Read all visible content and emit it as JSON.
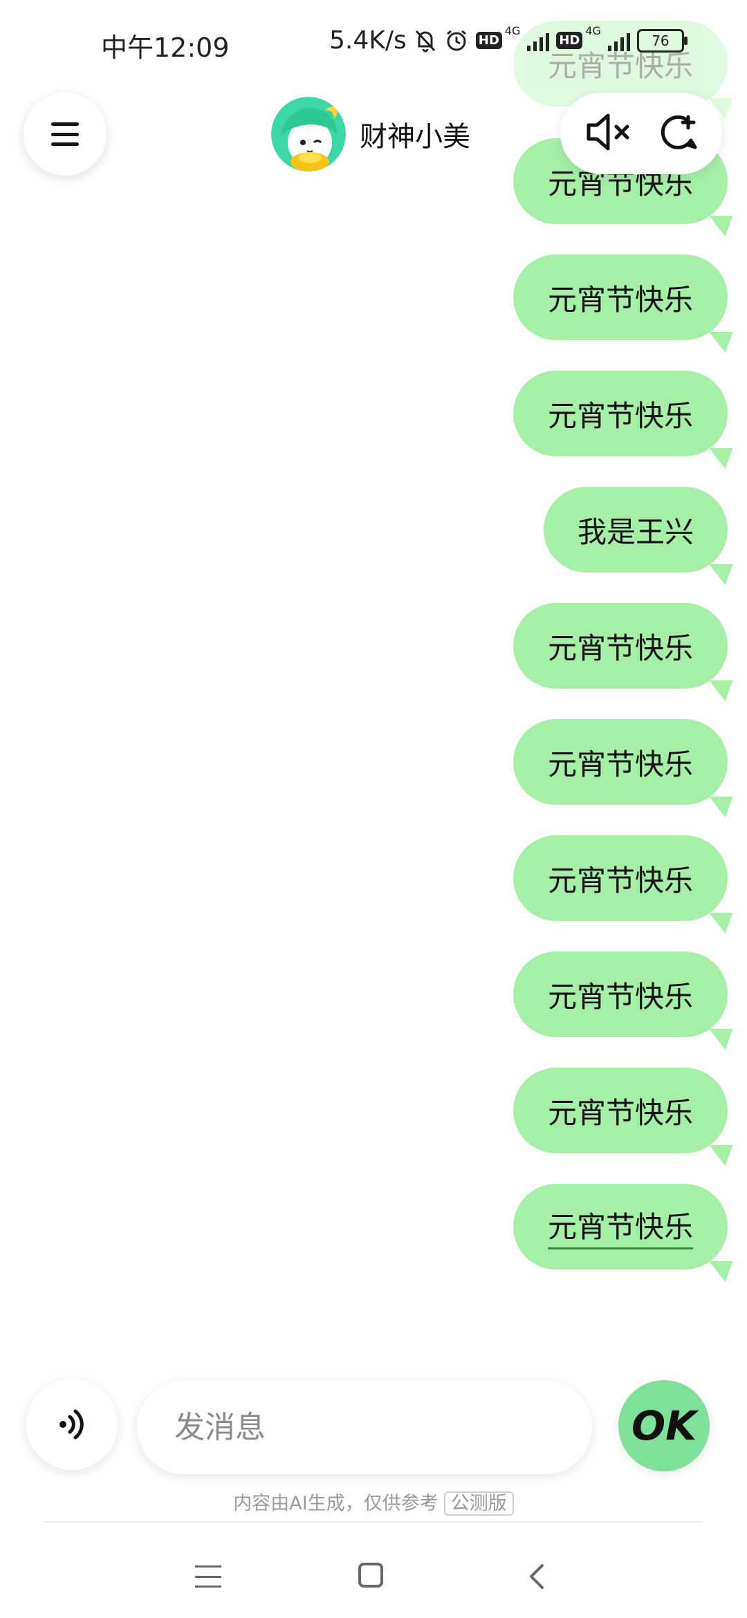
{
  "status_bar": {
    "time": "中午12:09",
    "speed": "5.4K/s",
    "hd1": "HD",
    "net1": "4G",
    "hd2": "HD",
    "net2": "4G",
    "battery": "76"
  },
  "header": {
    "title": "财神小美",
    "icons": {
      "menu": "menu-icon",
      "mute": "speaker-muted-icon",
      "new_chat": "new-chat-icon"
    }
  },
  "messages": [
    {
      "text": "元宵节快乐"
    },
    {
      "text": "元宵节快乐"
    },
    {
      "text": "元宵节快乐"
    },
    {
      "text": "元宵节快乐"
    },
    {
      "text": "我是王兴"
    },
    {
      "text": "元宵节快乐"
    },
    {
      "text": "元宵节快乐"
    },
    {
      "text": "元宵节快乐"
    },
    {
      "text": "元宵节快乐"
    },
    {
      "text": "元宵节快乐"
    },
    {
      "text": "元宵节快乐"
    }
  ],
  "input": {
    "placeholder": "发消息",
    "ok_label": "OK"
  },
  "footer": {
    "disclaimer": "内容由AI生成，仅供参考",
    "badge": "公测版"
  },
  "colors": {
    "bubble": "#a6efa6",
    "ok_button": "#7fe09a",
    "avatar_hair": "#3ed6a6"
  }
}
